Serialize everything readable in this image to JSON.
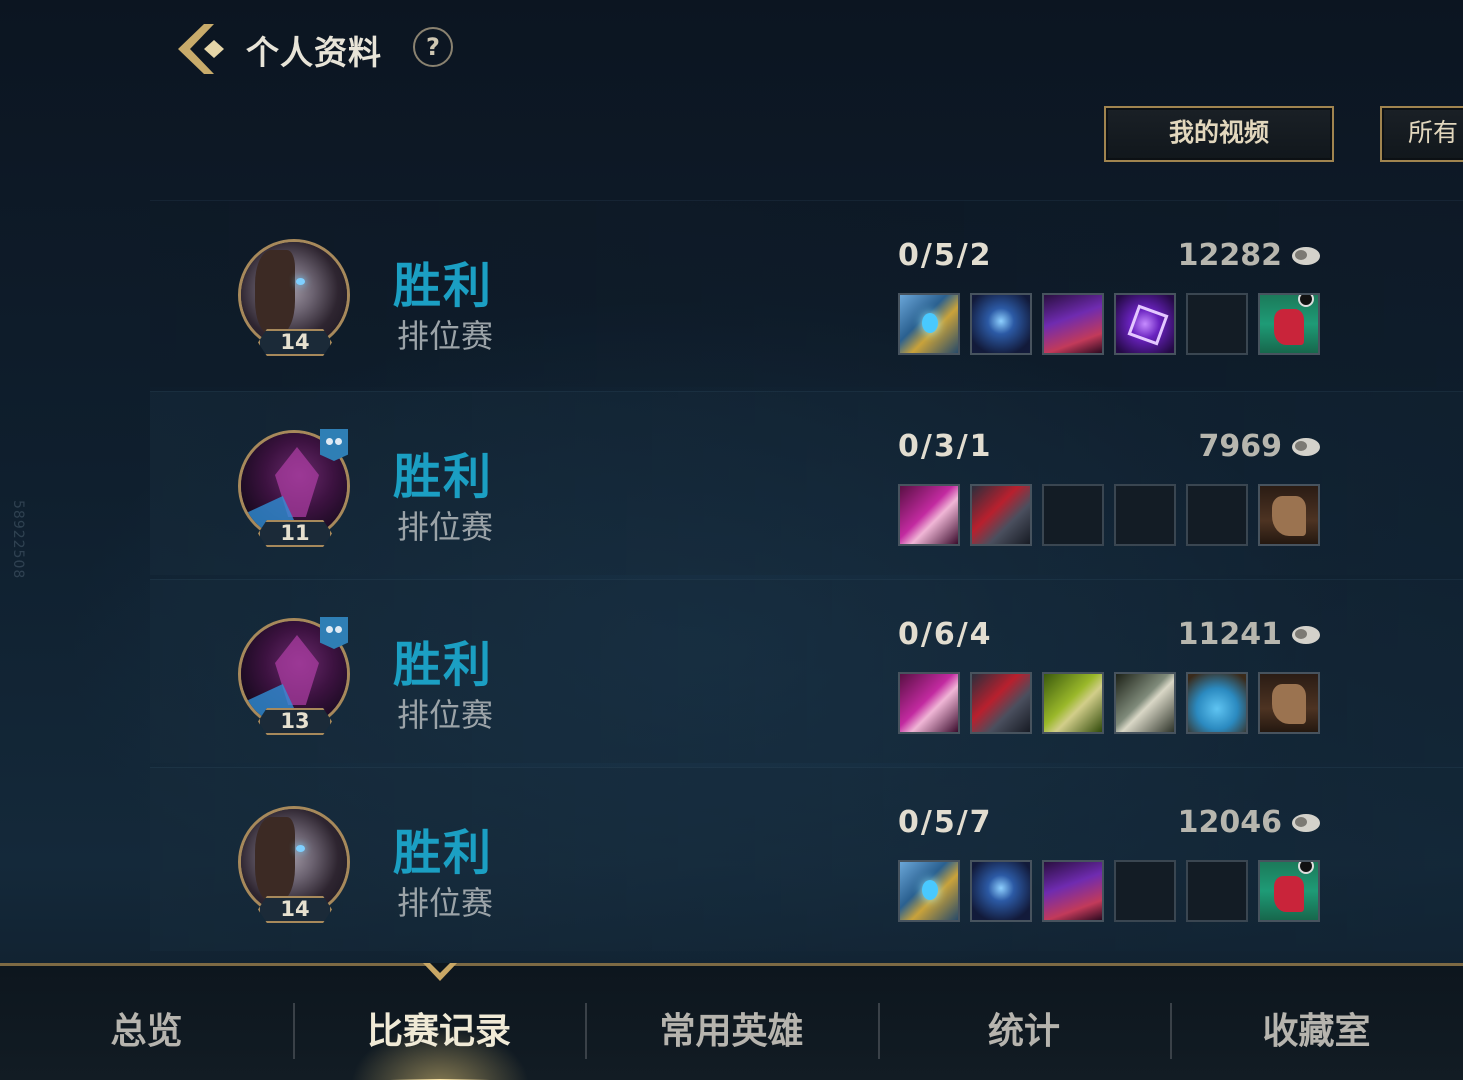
{
  "header": {
    "title": "个人资料",
    "help_label": "?",
    "videos_button": "我的视频",
    "all_button": "所有"
  },
  "side_watermark": "58922508",
  "matches": [
    {
      "result": "胜利",
      "mode": "排位赛",
      "level": "14",
      "kda": "0/5/2",
      "gold": "12282",
      "party": false,
      "items": [
        "staff-item-icon",
        "mask-item-icon",
        "hat-item-icon",
        "void-staff-item-icon",
        "empty",
        "red-boots-item-icon"
      ]
    },
    {
      "result": "胜利",
      "mode": "排位赛",
      "level": "11",
      "kda": "0/3/1",
      "gold": "7969",
      "party": true,
      "items": [
        "blade-item-icon",
        "axe-item-icon",
        "empty",
        "empty",
        "empty",
        "brown-boots-item-icon"
      ]
    },
    {
      "result": "胜利",
      "mode": "排位赛",
      "level": "13",
      "kda": "0/6/4",
      "gold": "11241",
      "party": true,
      "items": [
        "blade-item-icon",
        "axe-item-icon",
        "trident-item-icon",
        "sword-item-icon",
        "scale-armor-item-icon",
        "brown-boots-item-icon"
      ]
    },
    {
      "result": "胜利",
      "mode": "排位赛",
      "level": "14",
      "kda": "0/5/7",
      "gold": "12046",
      "party": false,
      "items": [
        "staff-item-icon",
        "mask-item-icon",
        "hat-item-icon",
        "empty",
        "empty",
        "red-boots-item-icon"
      ]
    }
  ],
  "bottom_nav": {
    "tabs": [
      {
        "label": "总览",
        "active": false
      },
      {
        "label": "比赛记录",
        "active": true
      },
      {
        "label": "常用英雄",
        "active": false
      },
      {
        "label": "统计",
        "active": false
      },
      {
        "label": "收藏室",
        "active": false
      }
    ]
  },
  "colors": {
    "victory": "#1b9fc3",
    "gold_border": "#a0844f",
    "nav_active": "#f0ead6"
  }
}
